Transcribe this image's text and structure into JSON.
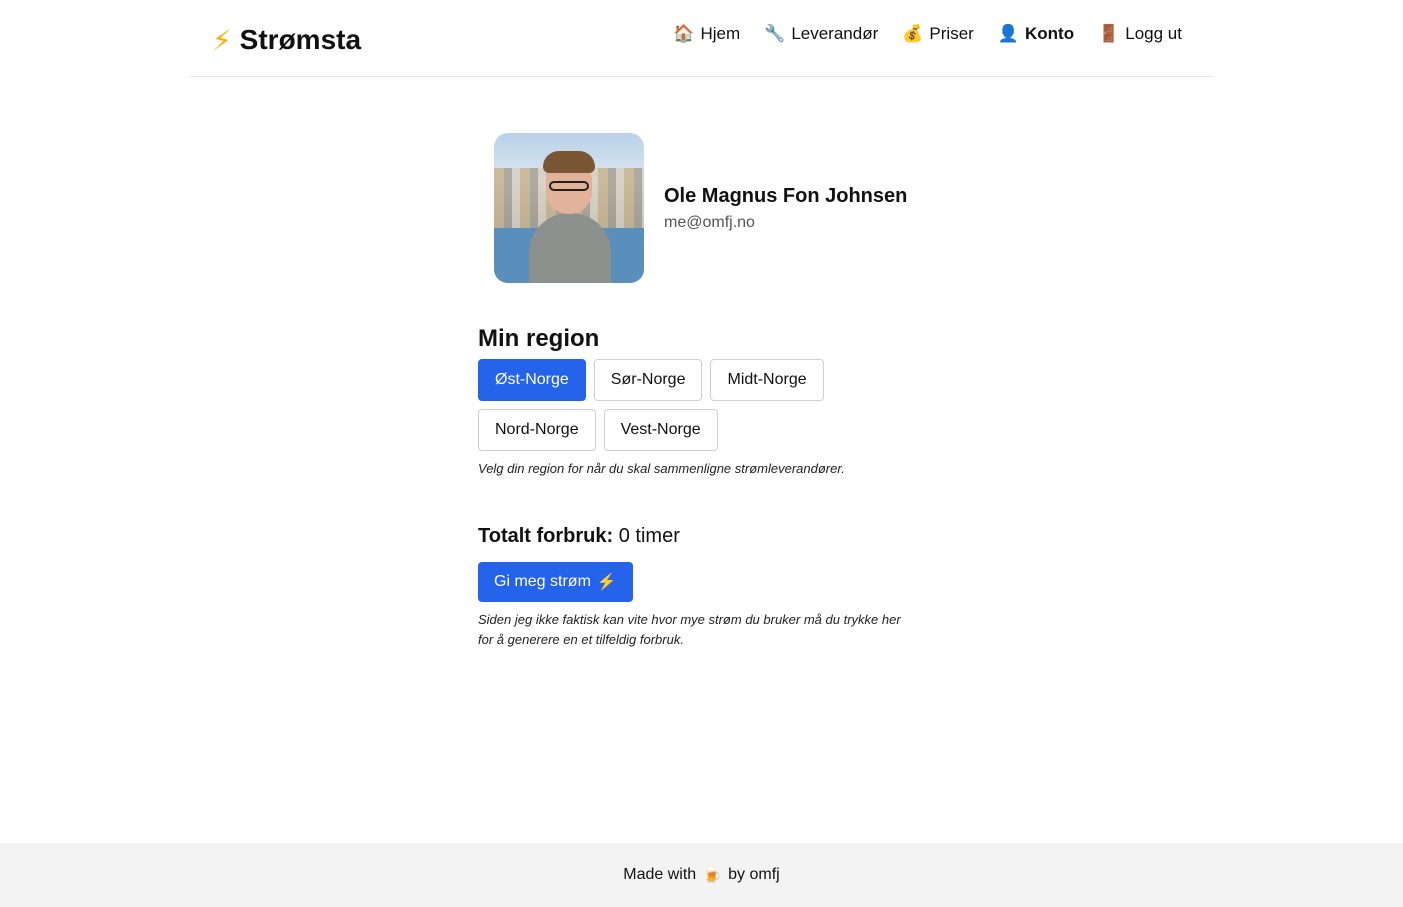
{
  "brand": {
    "icon": "lightning-bolt-icon",
    "icon_glyph": "⚡",
    "name": "Strømsta"
  },
  "nav": {
    "items": [
      {
        "icon": "house-icon",
        "glyph": "🏠",
        "label": "Hjem",
        "active": false
      },
      {
        "icon": "wrench-icon",
        "glyph": "🔧",
        "label": "Leverandør",
        "active": false
      },
      {
        "icon": "money-bag-icon",
        "glyph": "💰",
        "label": "Priser",
        "active": false
      },
      {
        "icon": "user-icon",
        "glyph": "👤",
        "label": "Konto",
        "active": true
      },
      {
        "icon": "door-icon",
        "glyph": "🚪",
        "label": "Logg ut",
        "active": false
      }
    ]
  },
  "profile": {
    "name": "Ole Magnus Fon Johnsen",
    "email": "me@omfj.no"
  },
  "region": {
    "title": "Min region",
    "options": [
      "Øst-Norge",
      "Sør-Norge",
      "Midt-Norge",
      "Nord-Norge",
      "Vest-Norge"
    ],
    "selected": "Øst-Norge",
    "hint": "Velg din region for når du skal sammenligne strømleverandører."
  },
  "usage": {
    "label": "Totalt forbruk:",
    "value": "0 timer",
    "button_label": "Gi meg strøm",
    "button_icon": "⚡",
    "hint": "Siden jeg ikke faktisk kan vite hvor mye strøm du bruker må du trykke her for å generere en et tilfeldig forbruk."
  },
  "footer": {
    "prefix": "Made with",
    "icon": "beer-icon",
    "icon_glyph": "🍺",
    "suffix": "by omfj"
  },
  "colors": {
    "primary": "#2563eb",
    "footer_bg": "#f3f3f3",
    "bolt": "#f5b400"
  }
}
